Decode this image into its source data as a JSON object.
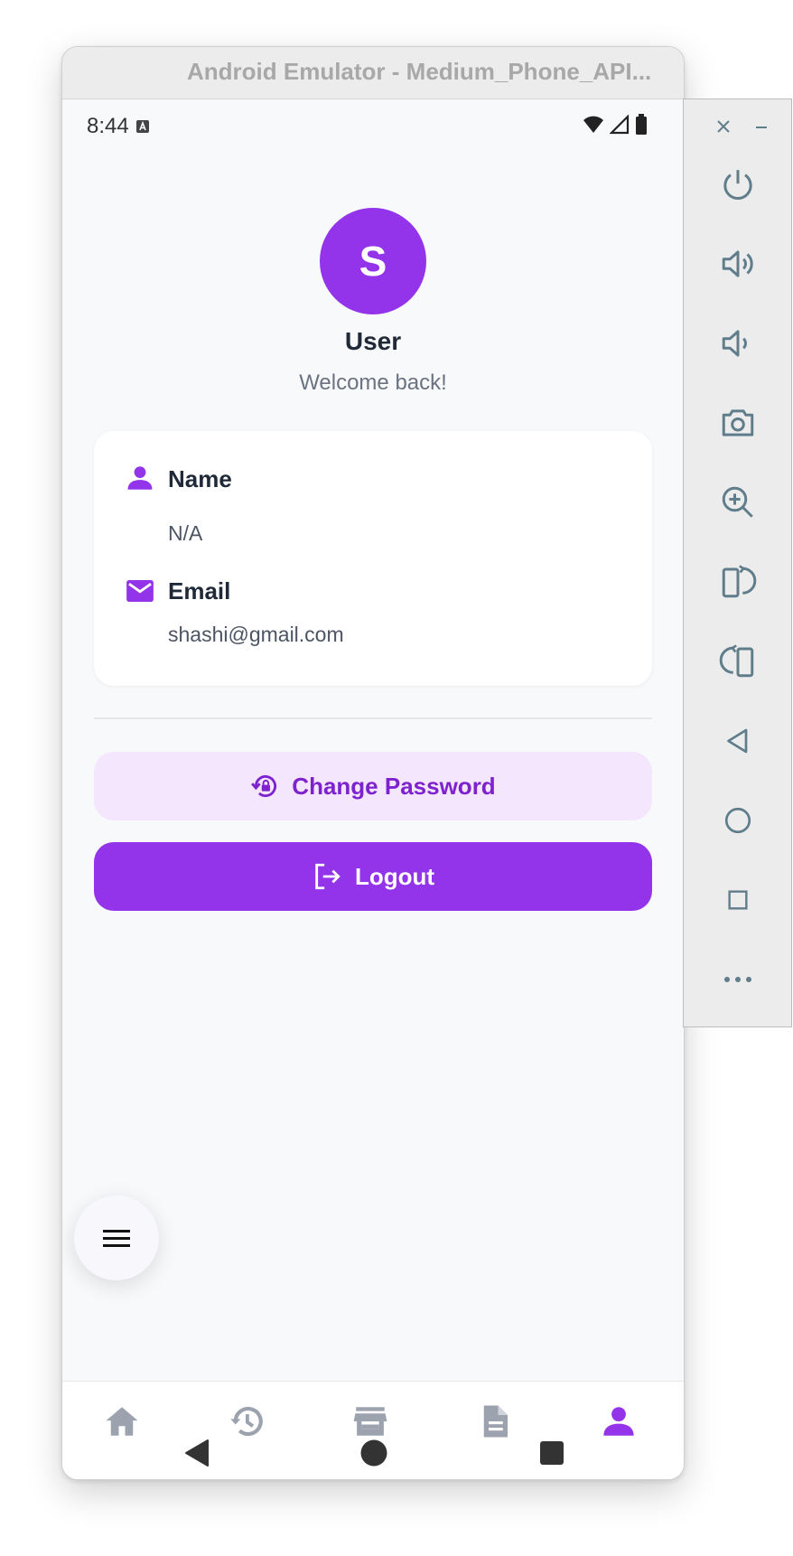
{
  "window": {
    "title": "Android Emulator - Medium_Phone_API..."
  },
  "status_bar": {
    "time": "8:44"
  },
  "profile": {
    "avatar_initial": "S",
    "name": "User",
    "subtitle": "Welcome back!"
  },
  "info_card": {
    "name_label": "Name",
    "name_value": "N/A",
    "email_label": "Email",
    "email_value": "shashi@gmail.com"
  },
  "actions": {
    "change_password_label": "Change Password",
    "logout_label": "Logout"
  },
  "bottom_nav": {
    "items": [
      {
        "icon": "home-icon",
        "active": false
      },
      {
        "icon": "history-icon",
        "active": false
      },
      {
        "icon": "store-icon",
        "active": false
      },
      {
        "icon": "document-icon",
        "active": false
      },
      {
        "icon": "person-icon",
        "active": true
      }
    ]
  },
  "side_toolbar": {
    "buttons": [
      "power-icon",
      "volume-up-icon",
      "volume-down-icon",
      "camera-icon",
      "zoom-in-icon",
      "rotate-left-icon",
      "rotate-right-icon",
      "back-icon",
      "home-icon",
      "overview-icon",
      "more-icon"
    ]
  },
  "colors": {
    "accent": "#9333ea",
    "accent_light": "#f3e6fd",
    "nav_inactive": "#9ca3af",
    "toolbar_icon": "#607d8b"
  }
}
